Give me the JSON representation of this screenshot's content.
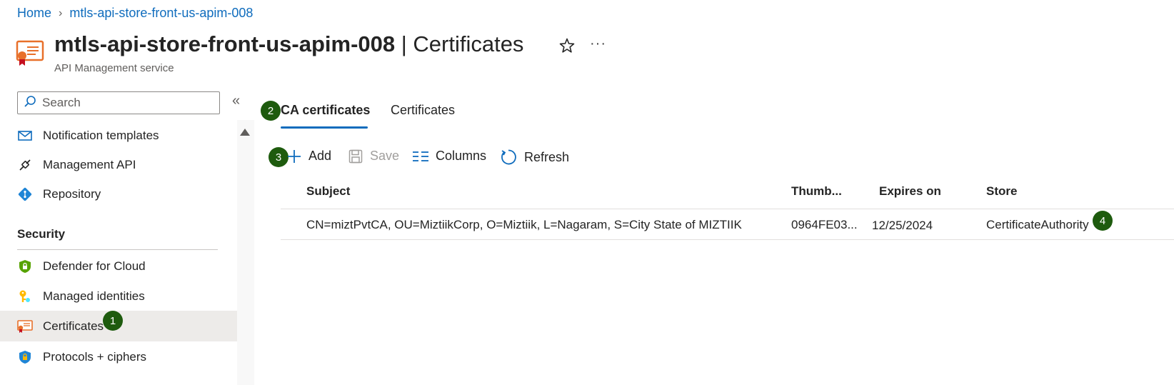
{
  "breadcrumb": {
    "home": "Home",
    "resource": "mtls-api-store-front-us-apim-008"
  },
  "header": {
    "name": "mtls-api-store-front-us-apim-008",
    "separator": " | ",
    "section": "Certificates",
    "subtitle": "API Management service",
    "more": "···"
  },
  "sidebar": {
    "search_placeholder": "Search",
    "items_top": [
      {
        "label": "Notification templates",
        "icon": "mail-icon"
      },
      {
        "label": "Management API",
        "icon": "plug-icon"
      },
      {
        "label": "Repository",
        "icon": "git-icon"
      }
    ],
    "security_header": "Security",
    "items_security": [
      {
        "label": "Defender for Cloud",
        "icon": "defender-shield-icon"
      },
      {
        "label": "Managed identities",
        "icon": "key-icon"
      },
      {
        "label": "Certificates",
        "icon": "certificate-icon",
        "selected": true
      },
      {
        "label": "Protocols + ciphers",
        "icon": "lock-shield-icon"
      }
    ]
  },
  "tabs": [
    {
      "label": "CA certificates",
      "active": true
    },
    {
      "label": "Certificates",
      "active": false
    }
  ],
  "toolbar": {
    "add": "Add",
    "save": "Save",
    "columns": "Columns",
    "refresh": "Refresh"
  },
  "grid": {
    "columns": [
      "Subject",
      "Thumb...",
      "Expires on",
      "Store"
    ],
    "rows": [
      {
        "subject": "CN=miztPvtCA, OU=MiztiikCorp, O=Miztiik, L=Nagaram, S=City State of MIZTIIK",
        "thumbprint": "0964FE03...",
        "expires": "12/25/2024",
        "store": "CertificateAuthority"
      }
    ]
  },
  "badges": [
    "1",
    "2",
    "3",
    "4"
  ],
  "colors": {
    "link": "#0f6cbd",
    "badge": "#1e5b0e",
    "selected_bg": "#edebe9"
  }
}
